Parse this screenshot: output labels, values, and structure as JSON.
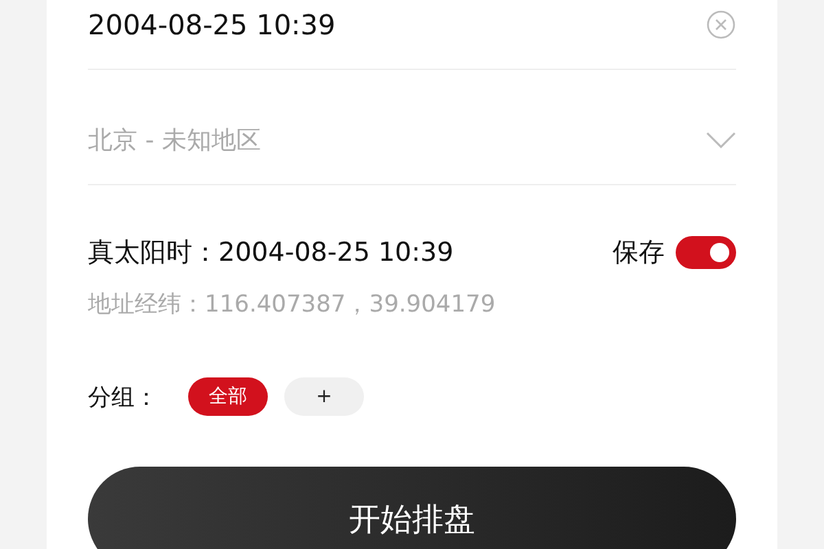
{
  "datetime_field": {
    "value": "2004-08-25 10:39"
  },
  "location_field": {
    "placeholder": "北京 - 未知地区"
  },
  "solar_time": {
    "label": "真太阳时：",
    "value": "2004-08-25 10:39"
  },
  "save_toggle": {
    "label": "保存",
    "on": true
  },
  "coordinates": {
    "label": "地址经纬：",
    "value": "116.407387，39.904179"
  },
  "group": {
    "label": "分组：",
    "chips": [
      {
        "label": "全部",
        "selected": true
      },
      {
        "label": "+",
        "selected": false
      }
    ]
  },
  "start_button": {
    "label": "开始排盘"
  }
}
